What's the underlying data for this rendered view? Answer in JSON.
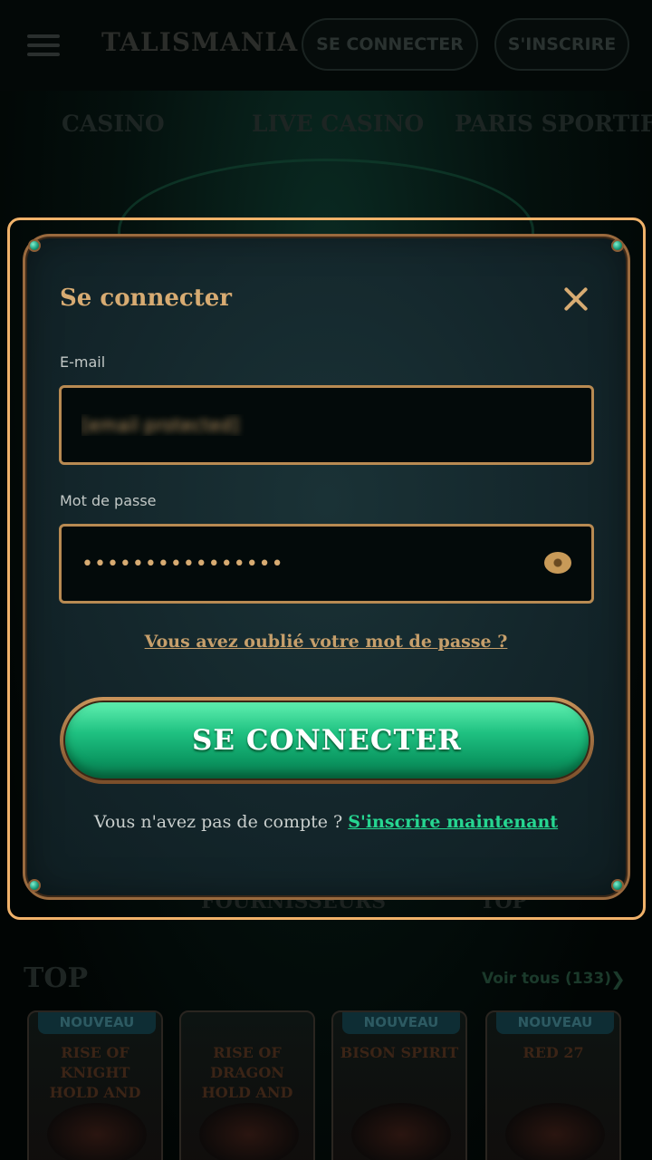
{
  "header": {
    "logo": "TALISMANIA",
    "login_label": "SE CONNECTER",
    "signup_label": "S'INSCRIRE"
  },
  "nav": {
    "tabs": [
      "CASINO",
      "LIVE CASINO",
      "PARIS SPORTIFS"
    ]
  },
  "behind_modal": {
    "providers_label": "FOURNISSEURS",
    "top_tab_label": "TOP"
  },
  "section": {
    "title": "TOP",
    "see_all": "Voir tous (133)"
  },
  "games": [
    {
      "badge": "NOUVEAU",
      "name": "RISE OF KNIGHT HOLD AND WIN"
    },
    {
      "badge": "",
      "name": "RISE OF DRAGON HOLD AND WIN"
    },
    {
      "badge": "NOUVEAU",
      "name": "BISON SPIRIT"
    },
    {
      "badge": "NOUVEAU",
      "name": "RED 27"
    }
  ],
  "modal": {
    "title": "Se connecter",
    "email_label": "E-mail",
    "email_value": "[email protected]",
    "password_label": "Mot de passe",
    "password_value": "••••••••••••••••",
    "forgot_link": "Vous avez oublié votre mot de passe ?",
    "submit_label": "SE CONNECTER",
    "no_account_text": "Vous n'avez pas de compte ?",
    "signup_link": "S'inscrire maintenant"
  },
  "colors": {
    "accent_gold": "#d7ab72",
    "cta_green": "#1fc181",
    "link_green": "#26d691",
    "modal_outline": "#f0b26a"
  }
}
